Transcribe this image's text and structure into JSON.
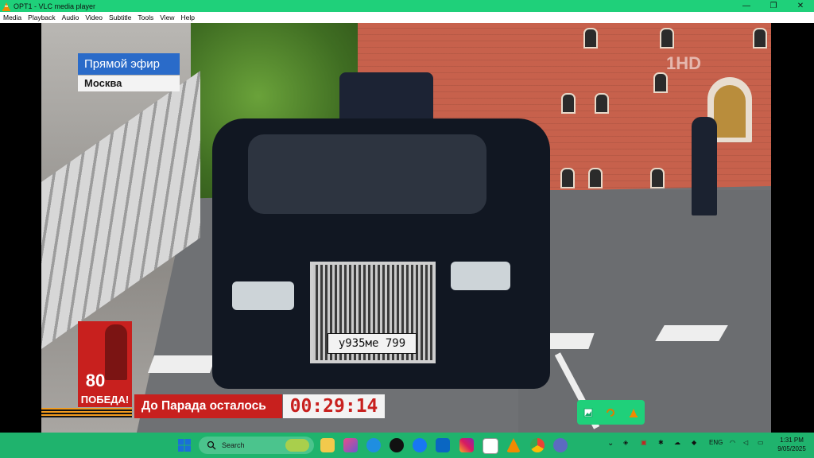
{
  "window": {
    "title": "OPT1 - VLC media player",
    "minimize": "—",
    "restore": "❐",
    "close": "✕"
  },
  "menu": [
    "Media",
    "Playback",
    "Audio",
    "Video",
    "Subtitle",
    "Tools",
    "View",
    "Help"
  ],
  "video": {
    "live_label": "Прямой эфир",
    "city_label": "Москва",
    "channel_logo": "1HD",
    "plate": "у935ме 799",
    "victory_number": "80",
    "victory_word": "ПОБЕДА!",
    "countdown_label": "До Парада осталось",
    "countdown_time": "00:29:14"
  },
  "mini_controls": [
    "picture-icon",
    "refresh-icon",
    "vlc-cone-icon"
  ],
  "taskbar": {
    "search_placeholder": "Search",
    "language": "ENG",
    "time": "1:31 PM",
    "date": "9/05/2025"
  },
  "colors": {
    "accent": "#1fd07a",
    "taskbar": "#1fb36d",
    "broadcast_red": "#c8201e",
    "broadcast_blue": "#2a6bc9"
  }
}
